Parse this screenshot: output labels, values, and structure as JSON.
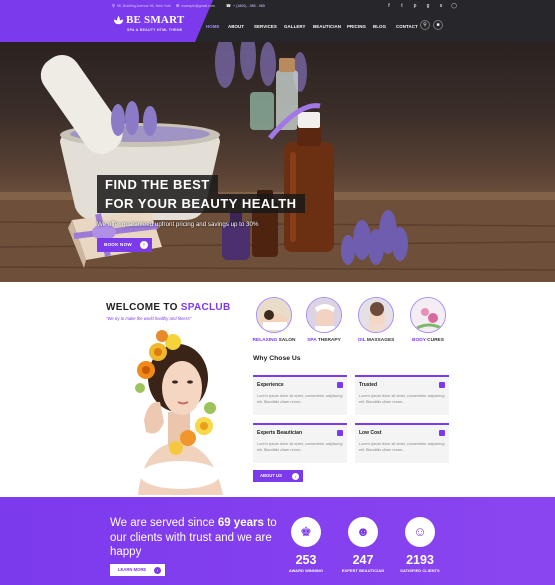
{
  "brand": {
    "name": "BE SMART",
    "tagline": "SPA & BEAUTY HTML THEME",
    "accent_color": "#7c3aed"
  },
  "topbar": {
    "address": "96, Building Avenue 96, New York",
    "email": "example@gmail.com",
    "phone": "+ (1800) - 985 - 985",
    "social": [
      "facebook-icon",
      "twitter-icon",
      "pinterest-icon",
      "google-plus-icon",
      "skype-icon",
      "instagram-icon"
    ]
  },
  "nav": {
    "items": [
      "HOME",
      "ABOUT",
      "SERVICES",
      "GALLERY",
      "BEAUTICIAN",
      "PRICING",
      "BLOG",
      "CONTACT"
    ],
    "active": "HOME",
    "search_icon": "search-icon",
    "cart_icon": "cart-icon"
  },
  "hero": {
    "line1": "FIND THE BEST",
    "line2": "FOR YOUR BEAUTY HEALTH",
    "subtitle": "We offer guaranteed upfront pricing and savings up to 30%",
    "button": "BOOK NOW"
  },
  "welcome": {
    "title_prefix": "WELCOME TO ",
    "title_accent": "SPACLUB",
    "subtitle": "\"We try to make the world healthy and fitness\""
  },
  "services": [
    {
      "accent": "RELAXING",
      "rest": " SALON"
    },
    {
      "accent": "SPA",
      "rest": " THERAPY"
    },
    {
      "accent": "OIL",
      "rest": " MASSAGES"
    },
    {
      "accent": "BODY",
      "rest": " CURES"
    }
  ],
  "why": {
    "title": "Why Chose Us",
    "cards": [
      {
        "title": "Experience",
        "text": "Lorem ipsum dolor sit amet, consectetur adipiscing elit. Blanditiis ullam rerum..."
      },
      {
        "title": "Trusted",
        "text": "Lorem ipsum dolor sit amet, consectetur adipiscing elit. Blanditiis ullam rerum..."
      },
      {
        "title": "Experts Beautician",
        "text": "Lorem ipsum dolor sit amet, consectetur adipiscing elit. Blanditiis ullam rerum..."
      },
      {
        "title": "Low Cost",
        "text": "Lorem ipsum dolor sit amet, consectetur adipiscing elit. Blanditiis ullam rerum..."
      }
    ],
    "button": "ABOUT US"
  },
  "band": {
    "text_a": "We are served since ",
    "text_b": "69 years",
    "text_c": "to our clients with trust and we are happy",
    "button": "LEARN MORE",
    "stats": [
      {
        "icon": "trophy-icon",
        "number": "253",
        "label": "AWARD WINNING"
      },
      {
        "icon": "users-icon",
        "number": "247",
        "label": "EXPERT BEAUTICIAN"
      },
      {
        "icon": "smile-icon",
        "number": "2193",
        "label": "SATISFIED CLIENTS"
      }
    ]
  }
}
